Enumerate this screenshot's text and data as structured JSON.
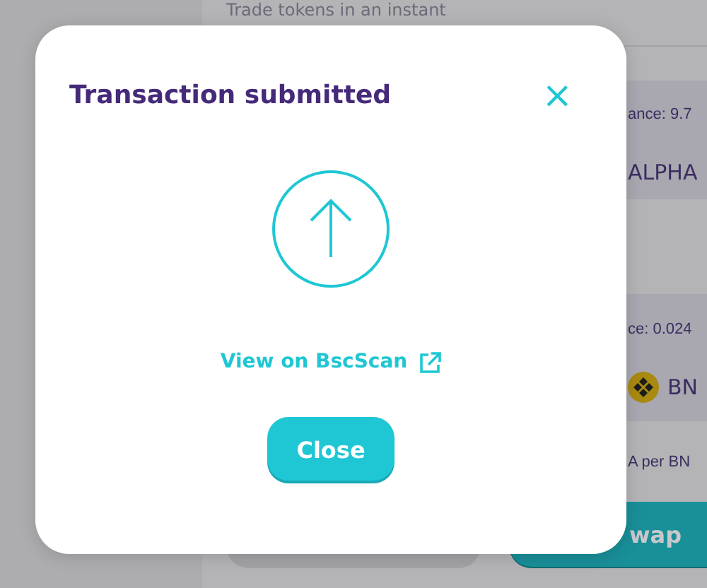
{
  "background": {
    "subtitle": "Trade tokens in an instant",
    "from_balance": "ance: 9.7",
    "from_token": "ALPHA",
    "to_balance": "ce: 0.024",
    "to_token": "BN",
    "rate": "A per BN",
    "swap_button": "wap"
  },
  "modal": {
    "title": "Transaction submitted",
    "close_icon": "×",
    "link": "View on BscScan",
    "button": "Close"
  }
}
